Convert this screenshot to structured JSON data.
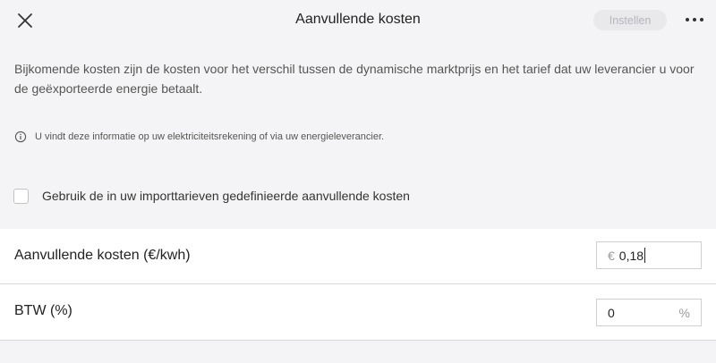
{
  "header": {
    "title": "Aanvullende kosten",
    "primary_button": "Instellen"
  },
  "description": "Bijkomende kosten zijn de kosten voor het verschil tussen de dynamische marktprijs en het tarief dat uw leverancier u voor de geëxporteerde energie betaalt.",
  "info_text": "U vindt deze informatie op uw elektriciteitsrekening of via uw energieleverancier.",
  "checkbox": {
    "label": "Gebruik de in uw importtarieven gedefinieerde aanvullende kosten",
    "checked": false
  },
  "fields": [
    {
      "label": "Aanvullende kosten (€/kwh)",
      "prefix": "€",
      "value": "0,18",
      "suffix": ""
    },
    {
      "label": "BTW (%)",
      "prefix": "",
      "value": "0",
      "suffix": "%"
    }
  ],
  "icons": {
    "close": "close-icon",
    "more": "more-icon",
    "info": "info-icon"
  }
}
